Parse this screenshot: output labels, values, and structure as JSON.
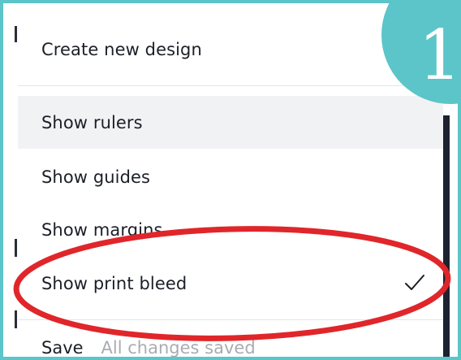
{
  "menu": {
    "create_new_design": "Create new design",
    "show_rulers": "Show rulers",
    "show_guides": "Show guides",
    "show_margins": "Show margins",
    "show_print_bleed": "Show print bleed",
    "save_label": "Save",
    "save_status": "All changes saved"
  },
  "step_badge": {
    "number": "1"
  },
  "colors": {
    "frame": "#5cc5c9",
    "badge": "#5cc5c9",
    "highlight_ring": "#e0262a",
    "hover_bg": "#f1f2f4"
  },
  "icons": {
    "print_bleed_state": "checkmark-icon"
  }
}
